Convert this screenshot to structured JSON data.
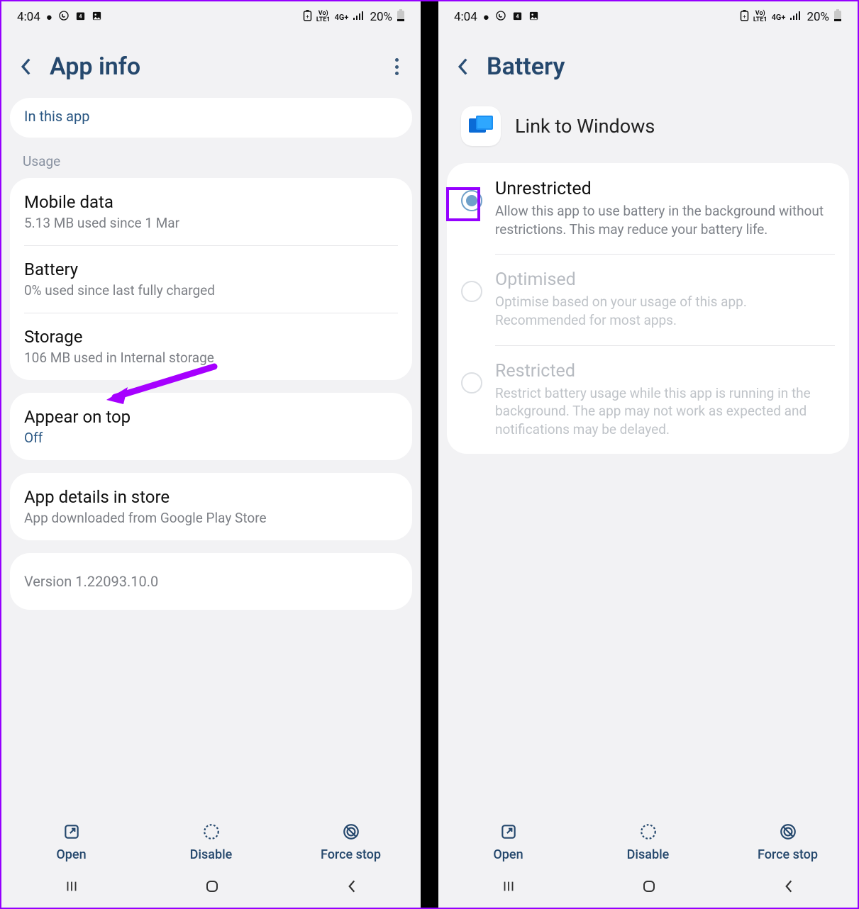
{
  "statusBar": {
    "time": "4:04",
    "lte_top": "Vo)",
    "lte_bot": "LTE1",
    "net": "4G+",
    "battery": "20%"
  },
  "screenA": {
    "headerTitle": "App info",
    "inThisApp": "In this app",
    "usageLabel": "Usage",
    "items": {
      "mobileData": {
        "title": "Mobile data",
        "sub": "5.13 MB used since 1 Mar"
      },
      "battery": {
        "title": "Battery",
        "sub": "0% used since last fully charged"
      },
      "storage": {
        "title": "Storage",
        "sub": "106 MB used in Internal storage"
      },
      "appearOnTop": {
        "title": "Appear on top",
        "sub": "Off"
      },
      "appDetails": {
        "title": "App details in store",
        "sub": "App downloaded from Google Play Store"
      }
    },
    "version": "Version 1.22093.10.0"
  },
  "screenB": {
    "headerTitle": "Battery",
    "appName": "Link to Windows",
    "options": {
      "unrestricted": {
        "title": "Unrestricted",
        "desc": "Allow this app to use battery in the background without restrictions. This may reduce your battery life."
      },
      "optimised": {
        "title": "Optimised",
        "desc": "Optimise based on your usage of this app. Recommended for most apps."
      },
      "restricted": {
        "title": "Restricted",
        "desc": "Restrict battery usage while this app is running in the background. The app may not work as expected and notifications may be delayed."
      }
    }
  },
  "actions": {
    "open": "Open",
    "disable": "Disable",
    "forceStop": "Force stop"
  }
}
